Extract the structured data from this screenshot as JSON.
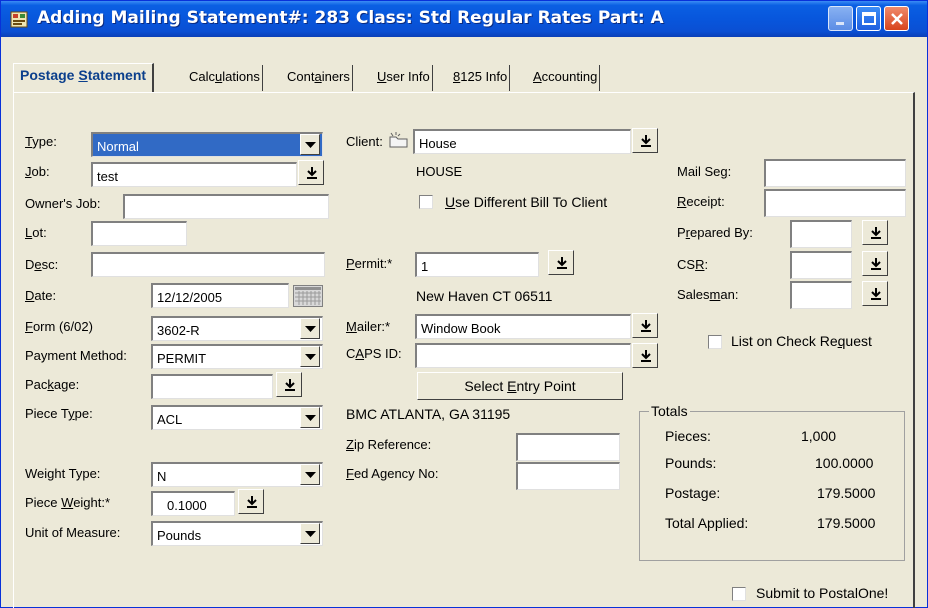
{
  "window": {
    "title": "Adding Mailing Statement#: 283 Class: Std Regular Rates Part: A",
    "title_bar_color": "#0a5fe3"
  },
  "tabs": [
    {
      "pre": "Postage ",
      "key": "S",
      "post": "tatement"
    },
    {
      "pre": "Calc",
      "key": "u",
      "post": "lations"
    },
    {
      "pre": "Cont",
      "key": "a",
      "post": "iners"
    },
    {
      "pre": "",
      "key": "U",
      "post": "ser Info"
    },
    {
      "pre": "",
      "key": "8",
      "post": "125 Info"
    },
    {
      "pre": "",
      "key": "A",
      "post": "ccounting"
    }
  ],
  "left": {
    "type_label": {
      "pre": "",
      "key": "T",
      "post": "ype:"
    },
    "type_value": "Normal",
    "job_label": {
      "pre": "",
      "key": "J",
      "post": "ob:"
    },
    "job_value": "test",
    "owners_job_label": "Owner's Job:",
    "owners_job_value": "",
    "lot_label": {
      "pre": "",
      "key": "L",
      "post": "ot:"
    },
    "lot_value": "",
    "desc_label": {
      "pre": "D",
      "key": "e",
      "post": "sc:"
    },
    "desc_value": "",
    "date_label": {
      "pre": "",
      "key": "D",
      "post": "ate:"
    },
    "date_value": "12/12/2005",
    "form_label": {
      "pre": "",
      "key": "F",
      "post": "orm (6/02)"
    },
    "form_value": "3602-R",
    "payment_label": "Payment Method:",
    "payment_value": "PERMIT",
    "package_label": {
      "pre": "Pac",
      "key": "k",
      "post": "age:"
    },
    "package_value": "",
    "piece_type_label": {
      "pre": "Piece T",
      "key": "y",
      "post": "pe:"
    },
    "piece_type_value": "ACL",
    "weight_type_label": {
      "pre": "Wei",
      "key": "g",
      "post": "ht Type:"
    },
    "weight_type_value": "N",
    "piece_weight_label": {
      "pre": "Piece ",
      "key": "W",
      "post": "eight:*"
    },
    "piece_weight_value": "0.1000",
    "unit_label": "Unit of Measure:",
    "unit_value": "Pounds"
  },
  "middle": {
    "client_label": "Client:",
    "client_value": "House",
    "client_name": "HOUSE",
    "use_diff_bill_label": {
      "pre": "",
      "key": "U",
      "post": "se Different Bill To Client"
    },
    "permit_label": {
      "pre": "",
      "key": "P",
      "post": "ermit:*"
    },
    "permit_value": "1",
    "permit_location": "New Haven CT 06511",
    "mailer_label": {
      "pre": "",
      "key": "M",
      "post": "ailer:*"
    },
    "mailer_value": "Window Book",
    "caps_label": {
      "pre": "C",
      "key": "A",
      "post": "PS ID:"
    },
    "caps_value": "",
    "select_entry_label": {
      "pre": "Select ",
      "key": "E",
      "post": "ntry Point"
    },
    "entry_point": "BMC ATLANTA, GA  31195",
    "zip_ref_label": {
      "pre": "",
      "key": "Z",
      "post": "ip Reference:"
    },
    "zip_ref_value": "",
    "fed_agency_label": {
      "pre": "",
      "key": "F",
      "post": "ed Agency No:"
    },
    "fed_agency_value": ""
  },
  "right": {
    "mail_seg_label": {
      "pre": "Mail Se",
      "key": "g",
      "post": ":"
    },
    "mail_seg_value": "",
    "receipt_label": {
      "pre": "",
      "key": "R",
      "post": "eceipt:"
    },
    "receipt_value": "",
    "prepared_by_label": {
      "pre": "P",
      "key": "r",
      "post": "epared By:"
    },
    "prepared_by_value": "",
    "csr_label": {
      "pre": "CS",
      "key": "R",
      "post": ":"
    },
    "csr_value": "",
    "salesman_label": {
      "pre": "Sales",
      "key": "m",
      "post": "an:"
    },
    "salesman_value": "",
    "list_check_label": {
      "pre": "List on Check Re",
      "key": "q",
      "post": "uest"
    }
  },
  "totals": {
    "title": "Totals",
    "pieces_label": "Pieces:",
    "pieces_value": "1,000",
    "pounds_label": "Pounds:",
    "pounds_value": "100.0000",
    "postage_label": "Postage:",
    "postage_value": "179.5000",
    "applied_label": "Total Applied:",
    "applied_value": "179.5000"
  },
  "submit_label": "Submit to PostalOne!",
  "icons": {
    "app": "form-icon",
    "dropdown": "chevron-down-icon",
    "picker": "arrow-down-bar-icon",
    "calendar": "calendar-icon",
    "client": "folder-icon"
  }
}
